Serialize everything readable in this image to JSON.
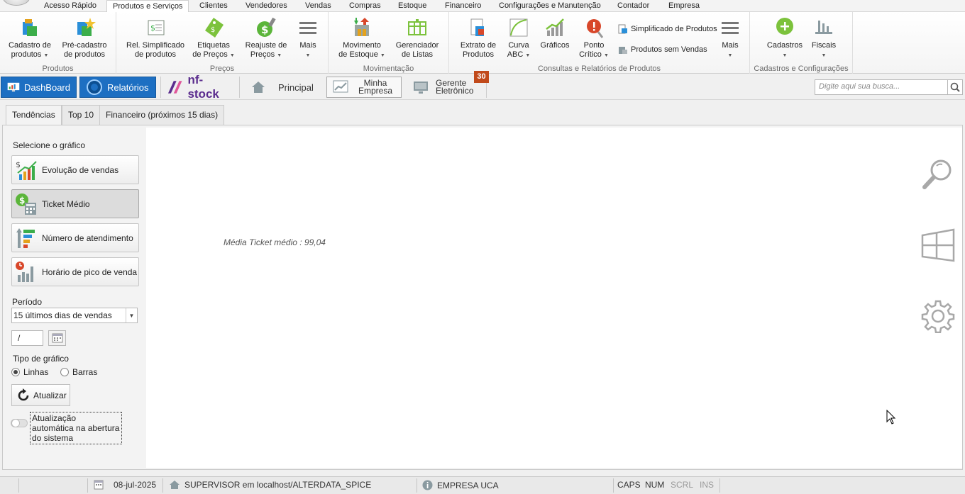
{
  "menu_tabs": [
    "Acesso Rápido",
    "Produtos e Serviços",
    "Clientes",
    "Vendedores",
    "Vendas",
    "Compras",
    "Estoque",
    "Financeiro",
    "Configurações e Manutenção",
    "Contador",
    "Empresa"
  ],
  "ribbon": {
    "groups": {
      "produtos": "Produtos",
      "precos": "Preços",
      "movimentacao": "Movimentação",
      "consultas": "Consultas e Relatórios de Produtos",
      "cadastros": "Cadastros e Configurações"
    },
    "buttons": {
      "cadastro_produtos": [
        "Cadastro de",
        "produtos"
      ],
      "pre_cadastro": [
        "Pré-cadastro",
        "de produtos"
      ],
      "rel_simplificado": [
        "Rel. Simplificado",
        "de produtos"
      ],
      "etiquetas": [
        "Etiquetas",
        "de Preços"
      ],
      "reajuste": [
        "Reajuste de",
        "Preços"
      ],
      "mais_precos": "Mais",
      "movimento_estoque": [
        "Movimento",
        "de Estoque"
      ],
      "gerenciador_listas": [
        "Gerenciador",
        "de Listas"
      ],
      "extrato_produtos": [
        "Extrato de",
        "Produtos"
      ],
      "curva_abc": [
        "Curva",
        "ABC"
      ],
      "graficos": "Gráficos",
      "ponto_critico": [
        "Ponto",
        "Crítico"
      ],
      "simplificado_produtos": "Simplificado de Produtos",
      "produtos_sem_vendas": "Produtos sem Vendas",
      "mais_consultas": "Mais",
      "cadastros": "Cadastros",
      "fiscais": "Fiscais"
    }
  },
  "quickbar": {
    "dashboard": "DashBoard",
    "relatorios": "Relatórios",
    "nfstock_logo": "nf-stock",
    "principal": "Principal",
    "minha_empresa": [
      "Minha",
      "Empresa"
    ],
    "gerente_eletronico": [
      "Gerente",
      "Eletrônico"
    ],
    "badge": "30",
    "search_placeholder": "Digite aqui sua busca..."
  },
  "content_tabs": [
    "Tendências",
    "Top 10",
    "Financeiro (próximos 15 dias)"
  ],
  "left_panel": {
    "select_chart_label": "Selecione o gráfico",
    "chart_buttons": [
      "Evolução de vendas",
      "Ticket Médio",
      "Número de atendimento",
      "Horário de pico de venda"
    ],
    "period_label": "Período",
    "period_value": "15 últimos dias de vendas",
    "date_value": "/",
    "chart_type_label": "Tipo de gráfico",
    "chart_type_options": [
      "Linhas",
      "Barras"
    ],
    "update_button": "Atualizar",
    "auto_update_label": "Atualização automática na abertura do sistema"
  },
  "main": {
    "ticket_text": "Média Ticket médio : 99,04"
  },
  "status_bar": {
    "date": "08-jul-2025",
    "user": "SUPERVISOR em localhost/ALTERDATA_SPICE",
    "company": "EMPRESA UCA",
    "caps": "CAPS",
    "num": "NUM",
    "scrl": "SCRL",
    "ins": "INS"
  },
  "colors": {
    "accent_blue": "#1d6fc2",
    "badge": "#c14a1b",
    "nfstock_purple": "#5b2d8e"
  }
}
